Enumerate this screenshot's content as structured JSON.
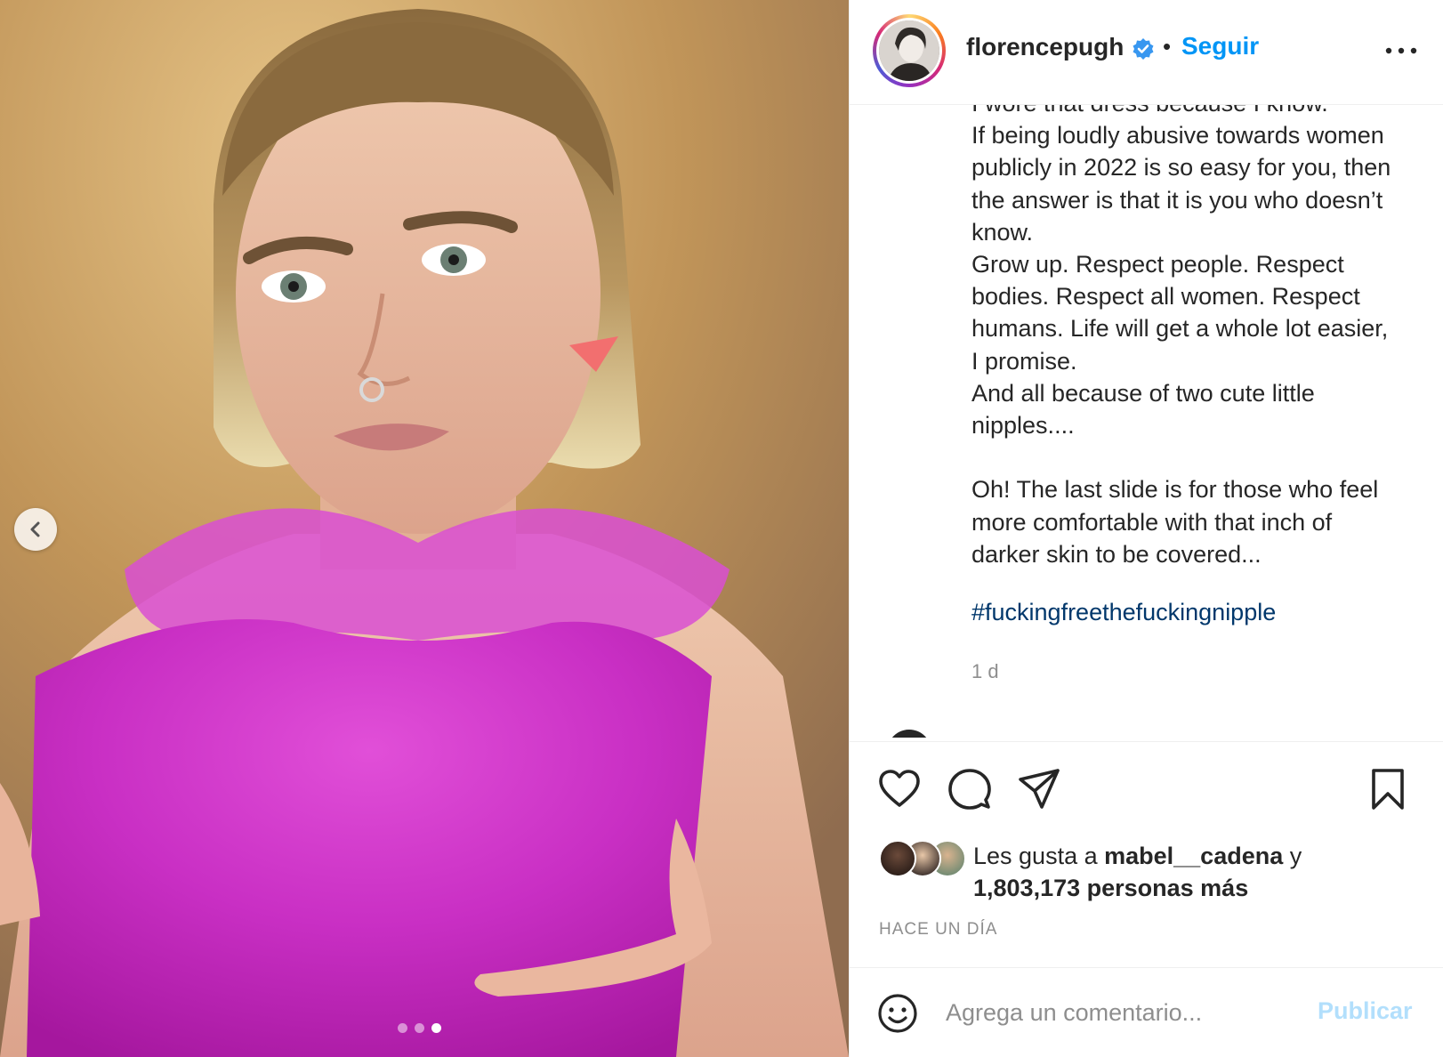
{
  "header": {
    "username": "florencepugh",
    "separator": "•",
    "follow_label": "Seguir"
  },
  "caption": {
    "text": "I wore that dress because I know.\nIf being loudly abusive towards women publicly in 2022 is so easy for you, then the answer is that it is you who doesn’t know.\nGrow up. Respect people. Respect bodies. Respect all women. Respect humans. Life will get a whole lot easier, I promise.\nAnd all because of two cute little nipples....\n\nOh! The last slide is for those who feel more comfortable with that inch of darker skin to be covered...",
    "hashtag": "#fuckingfreethefuckingnipple",
    "time": "1 d"
  },
  "likes": {
    "prefix": "Les gusta a ",
    "user": "mabel__cadena",
    "conjunction": " y",
    "count": "1,803,173 personas más"
  },
  "posted_ago": "HACE UN DÍA",
  "comment": {
    "placeholder": "Agrega un comentario...",
    "publish_label": "Publicar"
  },
  "carousel": {
    "total_slides": 3,
    "current_slide": 3
  },
  "icons": {
    "verified": "verified-badge-icon",
    "more": "more-options-icon",
    "like": "heart-icon",
    "comment": "comment-bubble-icon",
    "share": "paper-plane-icon",
    "save": "bookmark-icon",
    "emoji": "smiley-icon",
    "prev": "chevron-left-icon"
  },
  "colors": {
    "link_blue": "#0095f6",
    "hashtag": "#00376b",
    "verified": "#3897f0",
    "publish_disabled": "#b2dffc",
    "muted": "#8e8e8e"
  }
}
